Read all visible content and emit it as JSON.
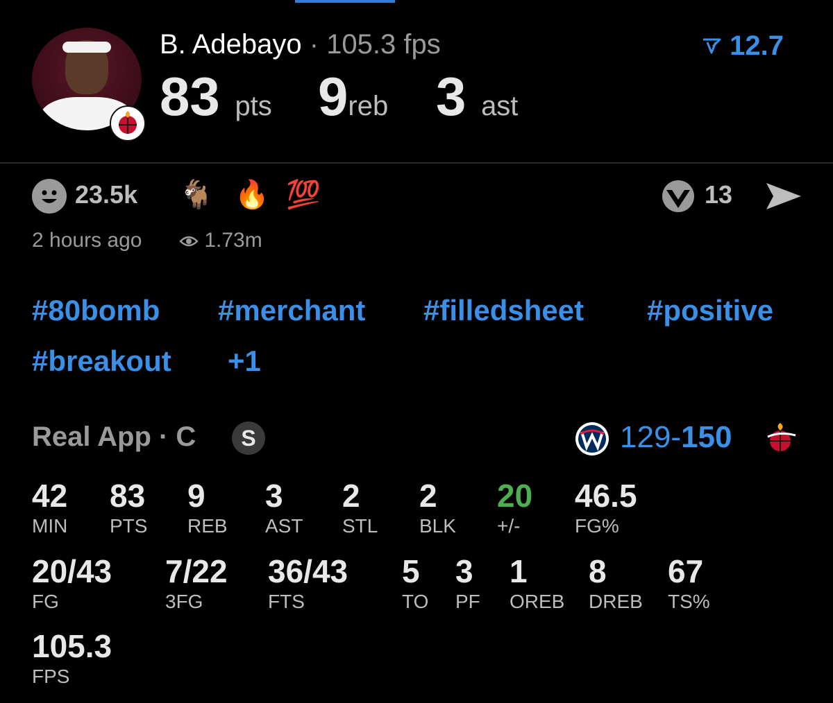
{
  "player": {
    "name": "B. Adebayo",
    "dot": "·",
    "fps": "105.3 fps",
    "pts": "83",
    "pts_unit": "pts",
    "reb": "9",
    "reb_unit": "reb",
    "ast": "3",
    "ast_unit": "ast",
    "rank": "12.7"
  },
  "social": {
    "reactions": "23.5k",
    "emojis": [
      "🐐",
      "🔥",
      "💯"
    ],
    "rv_count": "13",
    "time": "2 hours ago",
    "views": "1.73m"
  },
  "tags": [
    "#80bomb",
    "#merchant",
    "#filledsheet",
    "#positive",
    "#breakout",
    "+1"
  ],
  "game": {
    "source": "Real App · C",
    "badge": "S",
    "score_low": "129",
    "score_sep": "-",
    "score_high": "150"
  },
  "stats": {
    "row1": [
      {
        "value": "42",
        "label": "MIN"
      },
      {
        "value": "83",
        "label": "PTS"
      },
      {
        "value": "9",
        "label": "REB"
      },
      {
        "value": "3",
        "label": "AST"
      },
      {
        "value": "2",
        "label": "STL"
      },
      {
        "value": "2",
        "label": "BLK"
      },
      {
        "value": "20",
        "label": "+/-"
      },
      {
        "value": "46.5",
        "label": "FG%"
      }
    ],
    "row2": [
      {
        "value": "20/43",
        "label": "FG"
      },
      {
        "value": "7/22",
        "label": "3FG"
      },
      {
        "value": "36/43",
        "label": "FTS"
      },
      {
        "value": "5",
        "label": "TO"
      },
      {
        "value": "3",
        "label": "PF"
      },
      {
        "value": "1",
        "label": "OREB"
      },
      {
        "value": "8",
        "label": "DREB"
      },
      {
        "value": "67",
        "label": "TS%"
      }
    ],
    "row3": [
      {
        "value": "105.3",
        "label": "FPS"
      }
    ]
  },
  "colors": {
    "accent": "#3a8fe6",
    "positive": "#4caf50",
    "muted": "#9a9a9a"
  },
  "icons": [
    "player-avatar",
    "heat-logo-icon",
    "rank-icon",
    "smile-icon",
    "rv-icon",
    "send-icon",
    "eye-icon",
    "wizards-logo-icon"
  ]
}
